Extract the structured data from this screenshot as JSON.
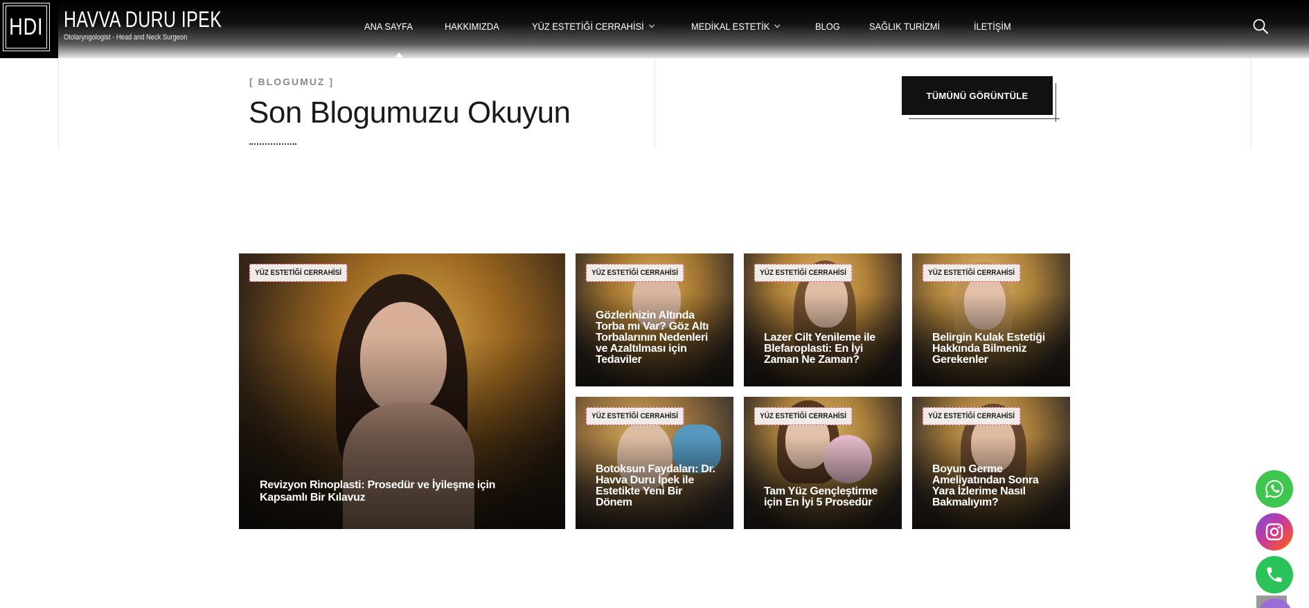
{
  "brand": {
    "logo_letters": "HDI",
    "name": "HAVVA DURU IPEK",
    "subtitle": "Otolaryngologist - Head and Neck Surgeon"
  },
  "nav": {
    "items": [
      {
        "label": "ANA SAYFA",
        "dropdown": false,
        "active": true
      },
      {
        "label": "HAKKIMIZDA",
        "dropdown": false
      },
      {
        "label": "YÜZ ESTETİĞİ CERRAHİSİ",
        "dropdown": true
      },
      {
        "label": "MEDİKAL ESTETİK",
        "dropdown": true
      },
      {
        "label": "BLOG",
        "dropdown": false
      },
      {
        "label": "SAĞLIK TURİZMİ",
        "dropdown": false
      },
      {
        "label": "İLETİŞİM",
        "dropdown": false
      }
    ],
    "search_icon": "search-icon"
  },
  "blog_section": {
    "eyebrow": "[ BLOGUMUZ ]",
    "title": "Son Blogumuzu Okuyun",
    "view_all_label": "TÜMÜNÜ GÖRÜNTÜLE"
  },
  "posts": [
    {
      "category": "YÜZ ESTETİĞİ CERRAHİSİ",
      "title": "Revizyon Rinoplasti: Prosedür ve İyileşme için Kapsamlı Bir Kılavuz"
    },
    {
      "category": "YÜZ ESTETİĞİ CERRAHİSİ",
      "title": "Gözlerinizin Altında Torba mı Var? Göz Altı Torbalarının Nedenleri ve Azaltılması için Tedaviler"
    },
    {
      "category": "YÜZ ESTETİĞİ CERRAHİSİ",
      "title": "Lazer Cilt Yenileme ile Blefaroplasti: En İyi Zaman Ne Zaman?"
    },
    {
      "category": "YÜZ ESTETİĞİ CERRAHİSİ",
      "title": "Belirgin Kulak Estetiği Hakkında Bilmeniz Gerekenler"
    },
    {
      "category": "YÜZ ESTETİĞİ CERRAHİSİ",
      "title": "Botoksun Faydaları: Dr. Havva Duru İpek ile Estetikte Yeni Bir Dönem"
    },
    {
      "category": "YÜZ ESTETİĞİ CERRAHİSİ",
      "title": "Tam Yüz Gençleştirme için En İyi 5 Prosedür"
    },
    {
      "category": "YÜZ ESTETİĞİ CERRAHİSİ",
      "title": "Boyun Germe Ameliyatından Sonra Yara İzlerime Nasıl Bakmalıyım?"
    }
  ],
  "floating": {
    "whatsapp_icon": "whatsapp-icon",
    "instagram_icon": "instagram-icon",
    "phone_icon": "phone-icon"
  },
  "colors": {
    "accent_tag_border": "#d24a6a",
    "whatsapp": "#3ec64e",
    "phone": "#2ac259"
  }
}
